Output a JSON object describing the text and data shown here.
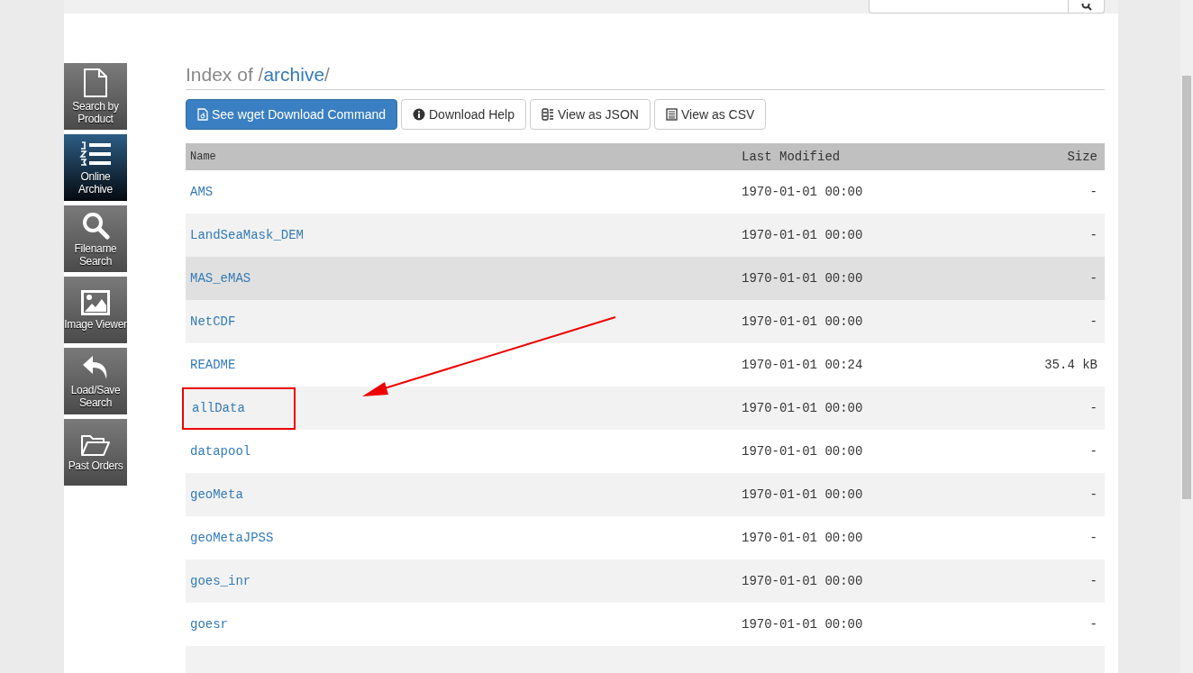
{
  "sidebar": {
    "items": [
      {
        "label": "Search by Product",
        "selected": false
      },
      {
        "label": "Online Archive",
        "selected": true
      },
      {
        "label": "Filename Search",
        "selected": false
      },
      {
        "label": "Image Viewer",
        "selected": false
      },
      {
        "label": "Load/Save Search",
        "selected": false
      },
      {
        "label": "Past Orders",
        "selected": false
      }
    ]
  },
  "heading": {
    "prefix": "Index of /",
    "link": "archive",
    "suffix": "/"
  },
  "buttons": [
    {
      "label": "See wget Download Command",
      "primary": true
    },
    {
      "label": "Download Help",
      "primary": false
    },
    {
      "label": "View as JSON",
      "primary": false
    },
    {
      "label": "View as CSV",
      "primary": false
    }
  ],
  "table": {
    "columns": [
      "Name",
      "Last Modified",
      "Size"
    ],
    "rows": [
      {
        "name": "AMS",
        "modified": "1970-01-01 00:00",
        "size": "-",
        "hovered": false,
        "highlighted": false
      },
      {
        "name": "LandSeaMask_DEM",
        "modified": "1970-01-01 00:00",
        "size": "-",
        "hovered": false,
        "highlighted": false
      },
      {
        "name": "MAS_eMAS",
        "modified": "1970-01-01 00:00",
        "size": "-",
        "hovered": true,
        "highlighted": false
      },
      {
        "name": "NetCDF",
        "modified": "1970-01-01 00:00",
        "size": "-",
        "hovered": false,
        "highlighted": false
      },
      {
        "name": "README",
        "modified": "1970-01-01 00:24",
        "size": "35.4 kB",
        "hovered": false,
        "highlighted": false
      },
      {
        "name": "allData",
        "modified": "1970-01-01 00:00",
        "size": "-",
        "hovered": false,
        "highlighted": true
      },
      {
        "name": "datapool",
        "modified": "1970-01-01 00:00",
        "size": "-",
        "hovered": false,
        "highlighted": false
      },
      {
        "name": "geoMeta",
        "modified": "1970-01-01 00:00",
        "size": "-",
        "hovered": false,
        "highlighted": false
      },
      {
        "name": "geoMetaJPSS",
        "modified": "1970-01-01 00:00",
        "size": "-",
        "hovered": false,
        "highlighted": false
      },
      {
        "name": "goes_inr",
        "modified": "1970-01-01 00:00",
        "size": "-",
        "hovered": false,
        "highlighted": false
      },
      {
        "name": "goesr",
        "modified": "1970-01-01 00:00",
        "size": "-",
        "hovered": false,
        "highlighted": false
      }
    ]
  }
}
